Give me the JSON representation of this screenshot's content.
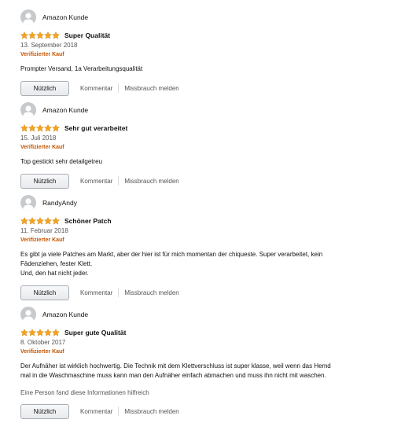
{
  "buttons": {
    "helpful": "Nützlich",
    "comment": "Kommentar",
    "report": "Missbrauch melden"
  },
  "colors": {
    "star": "#f4a41c",
    "verified": "#c45500",
    "avatar": "#c7cacd"
  },
  "reviews": [
    {
      "author": "Amazon Kunde",
      "rating": 5,
      "title": "Super Qualität",
      "date": "13. September 2018",
      "verified": "Verifizierter Kauf",
      "body_lines": [
        "Prompter Versand, 1a Verarbeitungsqualität"
      ],
      "helpful_count": null
    },
    {
      "author": "Amazon Kunde",
      "rating": 5,
      "title": "Sehr gut verarbeitet",
      "date": "15. Juli 2018",
      "verified": "Verifizierter Kauf",
      "body_lines": [
        "Top gestickt sehr detailgetreu"
      ],
      "helpful_count": null
    },
    {
      "author": "RandyAndy",
      "rating": 5,
      "title": "Schöner Patch",
      "date": "11. Februar 2018",
      "verified": "Verifizierter Kauf",
      "body_lines": [
        "Es gibt ja viele Patches am Markt, aber der hier ist für mich momentan der chiqueste. Super verarbeitet, kein",
        "Fädenziehen, fester Klett.",
        "Und, den hat nicht jeder."
      ],
      "helpful_count": null
    },
    {
      "author": "Amazon Kunde",
      "rating": 5,
      "title": "Super gute Qualität",
      "date": "8. Oktober 2017",
      "verified": "Verifizierter Kauf",
      "body_lines": [
        "Der Aufnäher ist wirklich hochwertig. Die Technik mit dem Klettverschluss ist super klasse, weil wenn das Hemd",
        "mal in die Waschmaschine muss kann man den Aufnäher einfach abmachen und muss ihn nicht mit waschen."
      ],
      "helpful_count": "Eine Person fand diese Informationen hilfreich"
    }
  ]
}
